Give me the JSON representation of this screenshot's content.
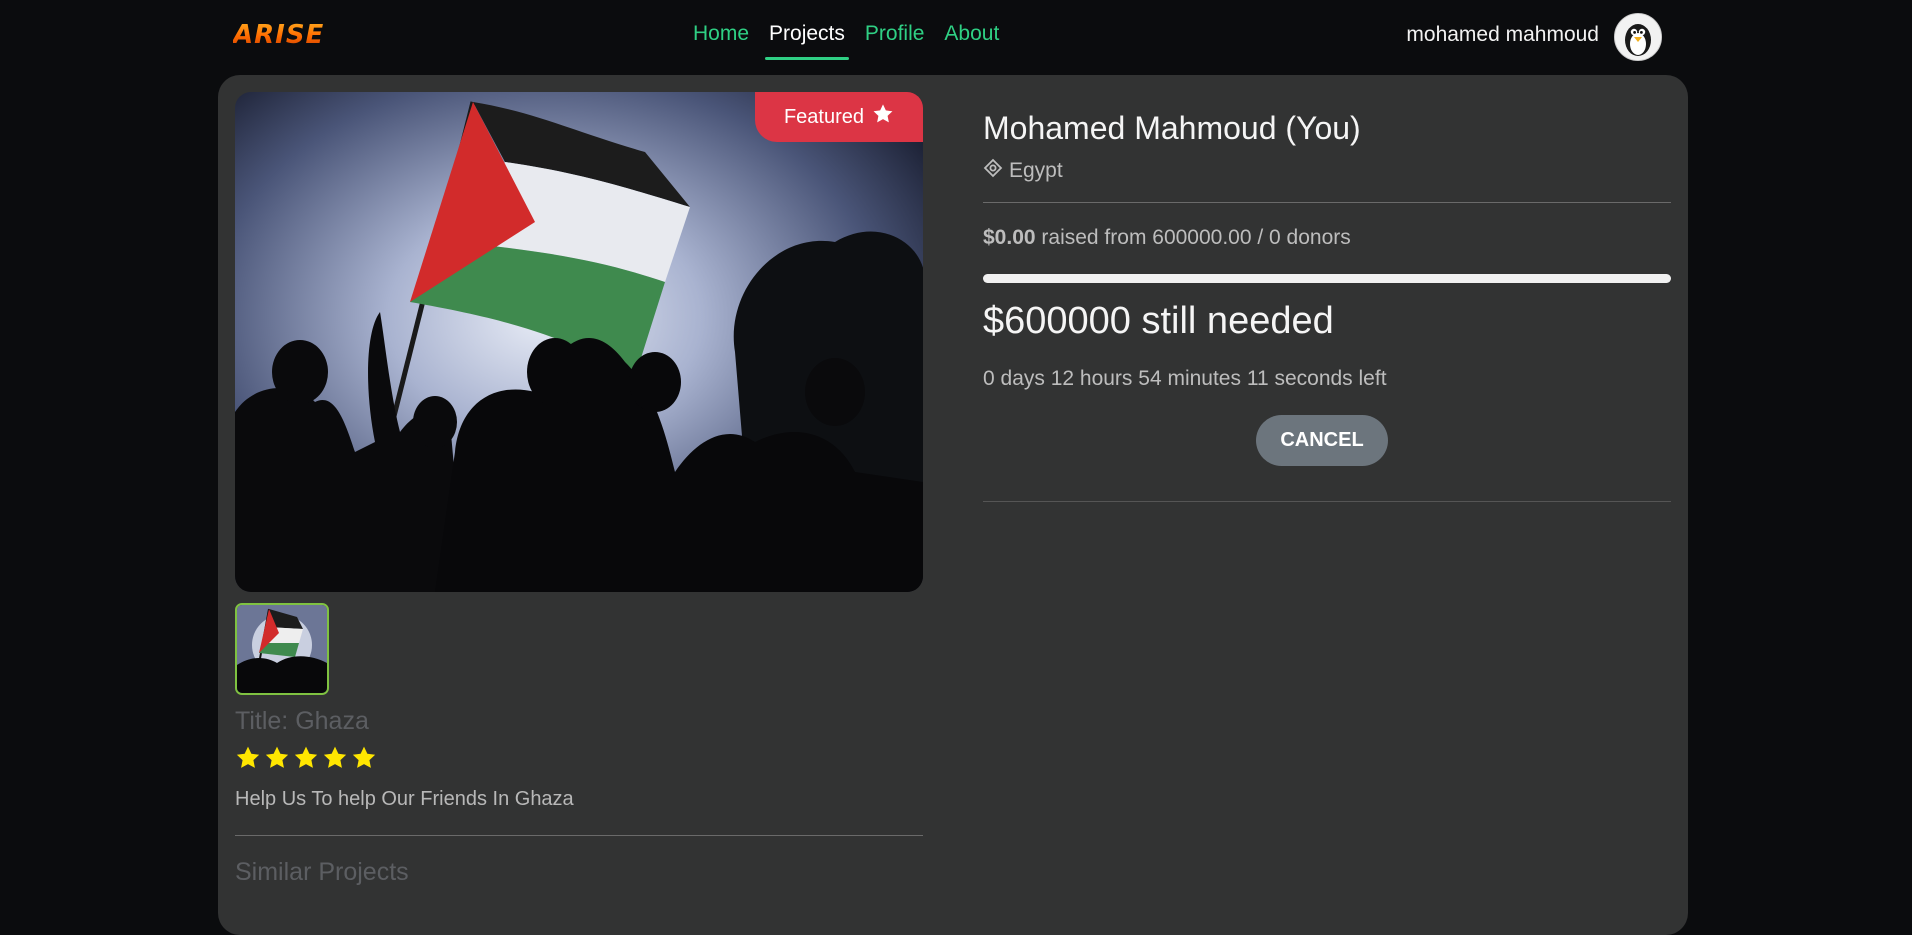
{
  "brand": {
    "logo_text": "ARISE"
  },
  "nav": {
    "links": [
      {
        "label": "Home",
        "active": false
      },
      {
        "label": "Projects",
        "active": true
      },
      {
        "label": "Profile",
        "active": false
      },
      {
        "label": "About",
        "active": false
      }
    ],
    "user_name": "mohamed mahmoud",
    "avatar_icon": "penguin-avatar-icon"
  },
  "project": {
    "featured_label": "Featured",
    "featured_icon": "star-icon",
    "title": "Title: Ghaza",
    "rating": 5,
    "rating_max": 5,
    "description": "Help Us To help Our Friends In Ghaza",
    "similar_heading": "Similar Projects"
  },
  "owner": {
    "name": "Mohamed Mahmoud (You)",
    "location_icon": "location-target-icon",
    "location": "Egypt"
  },
  "funding": {
    "raised_amount": "$0.00",
    "raised_text": "raised from 600000.00 / 0 donors",
    "progress_fraction": 0.0,
    "needed": "$600000 still needed",
    "time_left": "0 days 12 hours 54 minutes 11 seconds left",
    "cancel_label": "CANCEL"
  },
  "colors": {
    "accent": "#2fd084",
    "featured": "#dc3545",
    "card": "#323333",
    "background": "#0b0c0e",
    "star": "#ffe600"
  }
}
